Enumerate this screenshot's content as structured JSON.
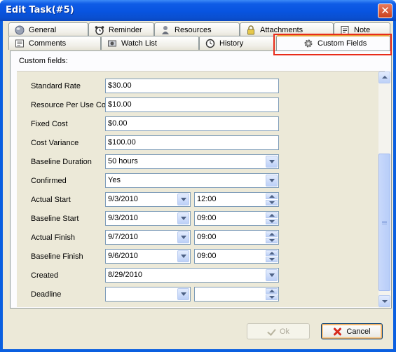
{
  "window": {
    "title": "Edit Task(#5)",
    "close_glyph": "✕"
  },
  "tabs_row1": [
    {
      "label": "General",
      "icon": "globe-icon"
    },
    {
      "label": "Reminder",
      "icon": "alarm-clock-icon"
    },
    {
      "label": "Resources",
      "icon": "person-icon"
    },
    {
      "label": "Attachments",
      "icon": "lock-icon"
    },
    {
      "label": "Note",
      "icon": "notepad-icon"
    }
  ],
  "tabs_row2": [
    {
      "label": "Comments",
      "icon": "comments-icon"
    },
    {
      "label": "Watch List",
      "icon": "watch-list-icon"
    },
    {
      "label": "History",
      "icon": "history-icon"
    },
    {
      "label": "Custom Fields",
      "icon": "gear-icon",
      "active": true
    }
  ],
  "panel": {
    "caption": "Custom fields:"
  },
  "fields": [
    {
      "label": "Standard Rate",
      "value": "$30.00"
    },
    {
      "label": "Resource Per Use Cost",
      "value": "$10.00"
    },
    {
      "label": "Fixed Cost",
      "value": "$0.00"
    },
    {
      "label": "Cost Variance",
      "value": "$100.00"
    },
    {
      "label": "Baseline Duration",
      "value": "50 hours"
    },
    {
      "label": "Confirmed",
      "value": "Yes"
    },
    {
      "label": "Actual Start",
      "date": "9/3/2010",
      "time": "12:00"
    },
    {
      "label": "Baseline Start",
      "date": "9/3/2010",
      "time": "09:00"
    },
    {
      "label": "Actual Finish",
      "date": "9/7/2010",
      "time": "09:00"
    },
    {
      "label": "Baseline Finish",
      "date": "9/6/2010",
      "time": "09:00"
    },
    {
      "label": "Created",
      "value": "8/29/2010"
    },
    {
      "label": "Deadline",
      "date": "",
      "time": ""
    }
  ],
  "buttons": {
    "ok": "Ok",
    "cancel": "Cancel"
  },
  "colors": {
    "title_bar": "#0854e0",
    "dialog_bg": "#ece9d8",
    "active_tab_highlight": "#e9a03a",
    "callout_border": "#e82b1a"
  }
}
